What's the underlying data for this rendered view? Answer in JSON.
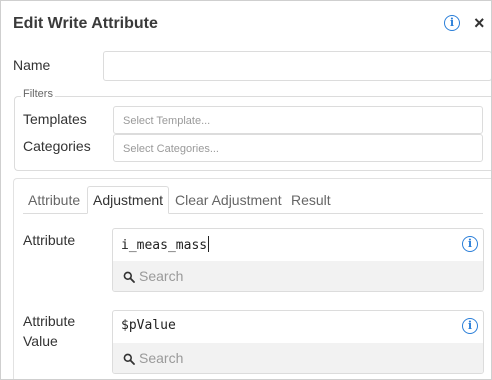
{
  "dialog": {
    "title": "Edit Write Attribute",
    "info_glyph": "i",
    "close_glyph": "×"
  },
  "name_field": {
    "label": "Name",
    "value": ""
  },
  "filters": {
    "legend": "Filters",
    "templates": {
      "label": "Templates",
      "placeholder": "Select Template..."
    },
    "categories": {
      "label": "Categories",
      "placeholder": "Select Categories..."
    }
  },
  "tabs": [
    {
      "label": "Attribute",
      "active": false
    },
    {
      "label": "Adjustment",
      "active": true
    },
    {
      "label": "Clear Adjustment",
      "active": false
    },
    {
      "label": "Result",
      "active": false
    }
  ],
  "attribute": {
    "label": "Attribute",
    "value": "i_meas_mass",
    "search_placeholder": "Search"
  },
  "attribute_value": {
    "label_line1": "Attribute",
    "label_line2": "Value",
    "value": "$pValue",
    "search_placeholder": "Search"
  },
  "colors": {
    "accent": "#2b7fd9",
    "border": "#dcdcdc",
    "search_bg": "#f2f2f2"
  },
  "icons": {
    "info": "info-circle-icon",
    "close": "close-icon",
    "search": "search-icon"
  }
}
